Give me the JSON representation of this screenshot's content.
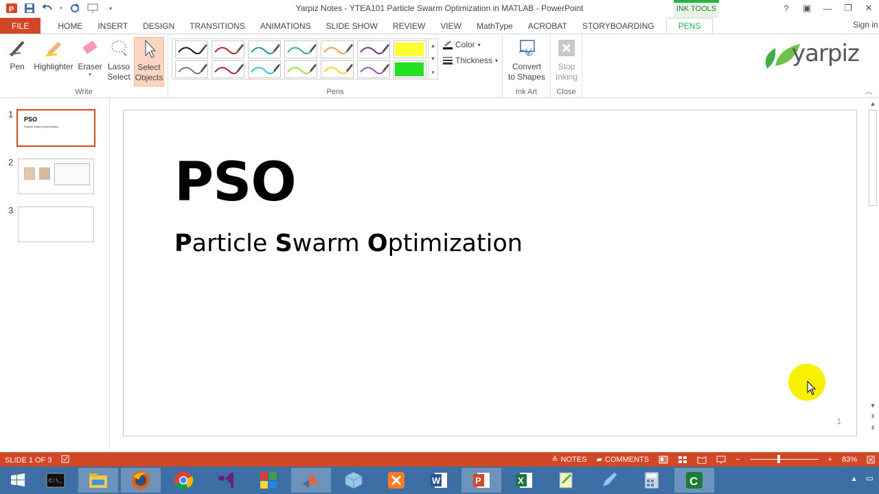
{
  "window": {
    "title": "Yarpiz Notes - YTEA101 Particle Swarm Optimization in MATLAB - PowerPoint",
    "contextual_tab_group": "INK TOOLS",
    "controls": [
      "?",
      "▣",
      "—",
      "❐",
      "✕"
    ]
  },
  "tabs": {
    "file": "FILE",
    "items": [
      "HOME",
      "INSERT",
      "DESIGN",
      "TRANSITIONS",
      "ANIMATIONS",
      "SLIDE SHOW",
      "REVIEW",
      "VIEW",
      "MathType",
      "ACROBAT",
      "STORYBOARDING"
    ],
    "active": "PENS",
    "sign_in": "Sign in"
  },
  "ribbon": {
    "write_group": {
      "label": "Write",
      "pen": "Pen",
      "highlighter": "Highlighter",
      "eraser": "Eraser",
      "lasso_line1": "Lasso",
      "lasso_line2": "Select",
      "select_line1": "Select",
      "select_line2": "Objects"
    },
    "pens_group": {
      "label": "Pens",
      "color": "Color",
      "thickness": "Thickness",
      "pen_colors_row1": [
        "#111111",
        "#b3202a",
        "#1f8db0",
        "#2bb673",
        "#e8a04c",
        "#7c2a8c",
        "#ffff33"
      ],
      "pen_colors_row2": [
        "#777777",
        "#b3202a",
        "#29c4e0",
        "#9be04a",
        "#f5d327",
        "#9b4fc0",
        "#22e022"
      ]
    },
    "ink_art_group": {
      "label": "Ink Art",
      "convert_line1": "Convert",
      "convert_line2": "to Shapes"
    },
    "close_group": {
      "label": "Close",
      "stop_line1": "Stop",
      "stop_line2": "Inking"
    },
    "brand": "yarpiz"
  },
  "thumbnails": {
    "numbers": [
      "1",
      "2",
      "3"
    ],
    "slide1_title": "PSO",
    "slide1_subtitle": "Particle Swarm Optimization"
  },
  "slide": {
    "title": "PSO",
    "subtitle_parts": [
      "P",
      "article ",
      "S",
      "warm ",
      "O",
      "ptimization"
    ],
    "number": "1"
  },
  "status": {
    "slide_info": "SLIDE 1 OF 3",
    "notes": "NOTES",
    "comments": "COMMENTS",
    "zoom": "83%"
  },
  "taskbar": {
    "apps": [
      "command-prompt",
      "file-explorer",
      "firefox",
      "chrome",
      "visual-studio",
      "app-grid",
      "matlab",
      "box-app",
      "xampp",
      "word",
      "powerpoint",
      "excel",
      "notepad-pp",
      "edit-tool",
      "calculator",
      "camtasia"
    ]
  }
}
